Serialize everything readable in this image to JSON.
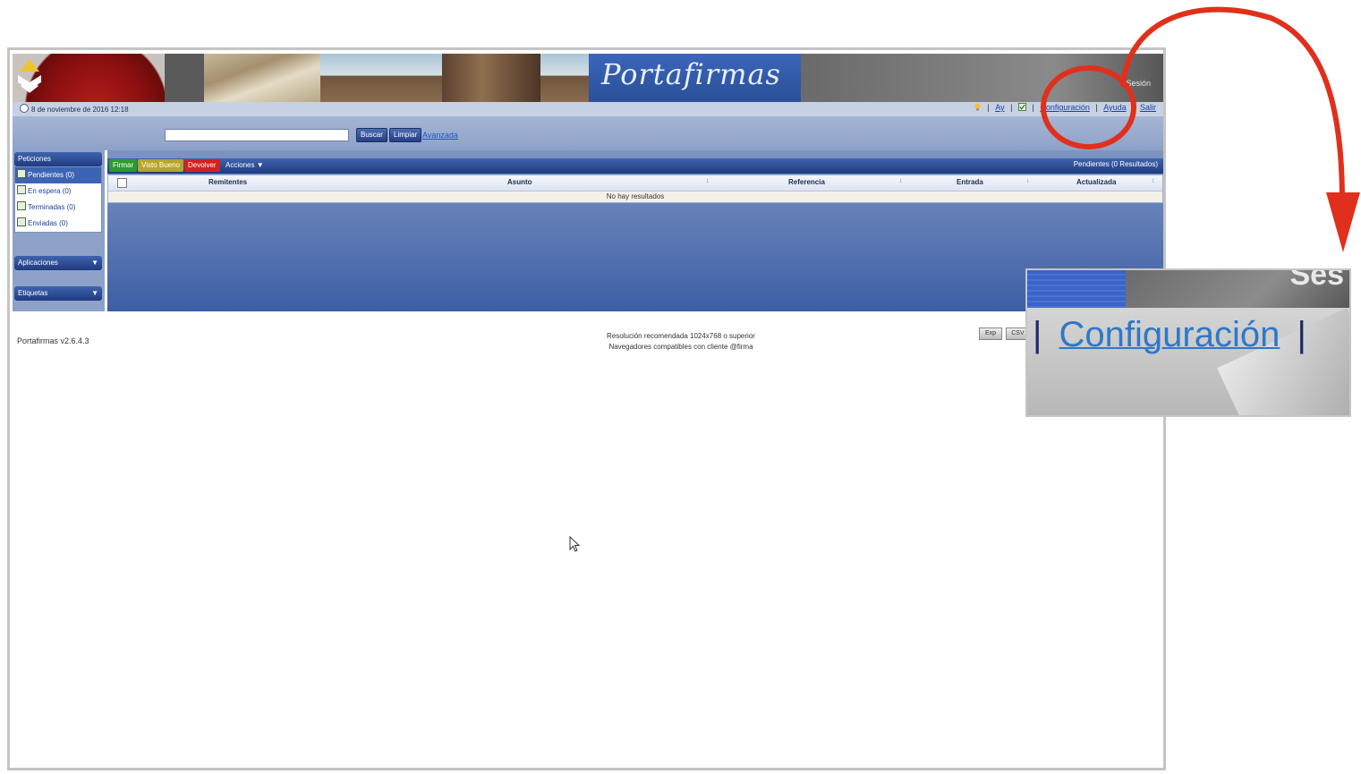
{
  "app": {
    "title": "Portafirmas",
    "date": "8 de noviembre de 2016 12:18",
    "user": "Sesión"
  },
  "toplinks": {
    "sep1": "|",
    "item1": "Ay",
    "sep2": "|",
    "sep3": "|",
    "config": "Configuración",
    "sep4": "|",
    "help": "Ayuda",
    "sep5": "|",
    "exit": "Salir"
  },
  "search": {
    "placeholder": "",
    "buscar": "Buscar",
    "limpiar": "Limpiar",
    "advanced": "Avanzada"
  },
  "sidebar": {
    "peticiones": "Peticiones",
    "items": [
      {
        "label": "Pendientes (0)"
      },
      {
        "label": "En espera (0)"
      },
      {
        "label": "Terminadas (0)"
      },
      {
        "label": "Enviadas (0)"
      }
    ],
    "aplicaciones": "Aplicaciones",
    "etiquetas": "Etiquetas"
  },
  "toolbar": {
    "firmar": "Firmar",
    "visto_bueno": "Visto Bueno",
    "devolver": "Devolver",
    "acciones": "Acciones",
    "results": "Pendientes (0 Resultados)"
  },
  "table": {
    "columns": [
      "Remitentes",
      "Asunto",
      "Referencia",
      "Entrada",
      "Actualizada"
    ],
    "empty_message": "No hay resultados"
  },
  "footer": {
    "version": "Portafirmas v2.6.4.3",
    "resolution": "Resolución recomendada 1024x768 o superior",
    "browsers": "Navegadores compatibles con cliente @firma",
    "btn1": "Exp",
    "btn2": "CSV"
  },
  "zoom": {
    "sep_left": "|",
    "config": "Configuración",
    "sep_right": "|",
    "user_fragment": "Ses"
  },
  "colors": {
    "annotation": "#e0301c",
    "header_blue": "#2a4f98",
    "link": "#2f78c7"
  }
}
